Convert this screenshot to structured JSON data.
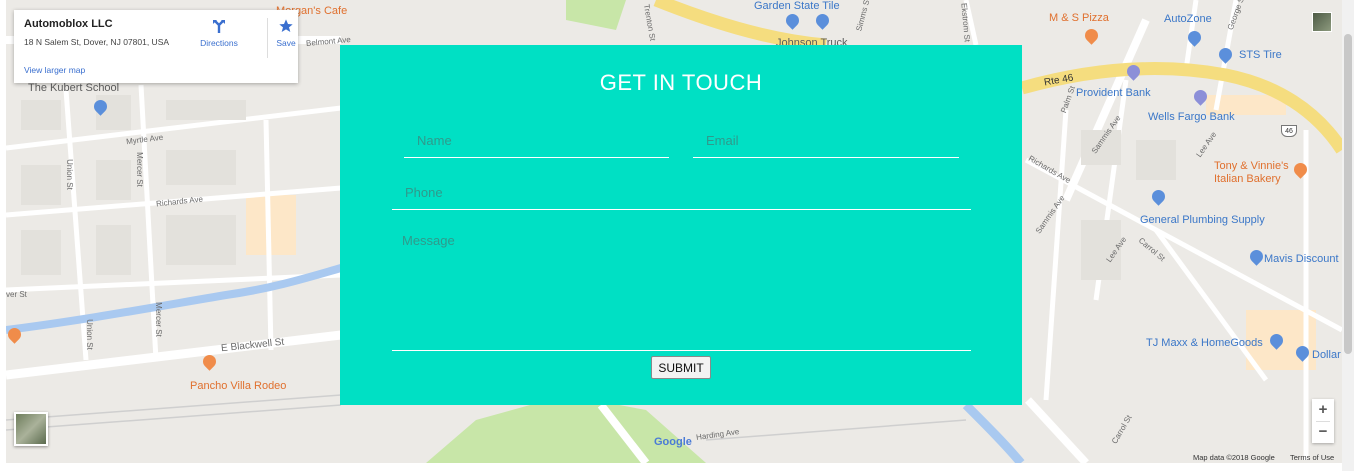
{
  "info_card": {
    "name": "Automoblox LLC",
    "address": "18 N Salem St, Dover, NJ 07801, USA",
    "directions": "Directions",
    "save": "Save",
    "view_larger": "View larger map"
  },
  "form": {
    "title": "GET IN TOUCH",
    "name_placeholder": "Name",
    "email_placeholder": "Email",
    "phone_placeholder": "Phone",
    "message_placeholder": "Message",
    "submit_label": "SUBMIT",
    "background": "#00e0c4"
  },
  "map": {
    "pois": {
      "morgans_cafe": "Morgan's Cafe",
      "kubert_school": "The Kubert School",
      "garden_state_tile": "Garden State Tile",
      "johnson_truck": "Johnson Truck",
      "ms_pizza": "M & S Pizza",
      "autozone": "AutoZone",
      "sts_tire": "STS Tire",
      "provident_bank": "Provident Bank",
      "wells_fargo": "Wells Fargo Bank",
      "tony_vinnies_1": "Tony & Vinnie's",
      "tony_vinnies_2": "Italian Bakery",
      "general_plumbing": "General Plumbing Supply",
      "mavis": "Mavis Discount",
      "tj_maxx": "TJ Maxx & HomeGoods",
      "dollar": "Dollar",
      "pancho_villa": "Pancho Villa Rodeo"
    },
    "streets": {
      "belmont": "Belmont Ave",
      "myrtle": "Myrtle Ave",
      "richards": "Richards Ave",
      "richards_2": "Richards Ave",
      "union_1": "Union St",
      "union_2": "Union St",
      "mercer_1": "Mercer St",
      "mercer_2": "Mercer St",
      "river": "ver St",
      "e_blackwell": "E Blackwell St",
      "rte46": "Rte 46",
      "palm": "Palm St",
      "sammis_1": "Sammis Ave",
      "sammis_2": "Sammis Ave",
      "lee_1": "Lee Ave",
      "lee_2": "Lee Ave",
      "carrol_1": "Carrol St",
      "carrol_2": "Carrol St",
      "harding": "Harding Ave",
      "trenton": "Trenton St",
      "ekstrom": "Ekstrom St",
      "george": "George St",
      "simms": "Simms St",
      "route_shield": "46"
    },
    "google_logo": "Google",
    "map_data": "Map data ©2018 Google",
    "terms": "Terms of Use",
    "zoom_in": "+",
    "zoom_out": "−"
  }
}
